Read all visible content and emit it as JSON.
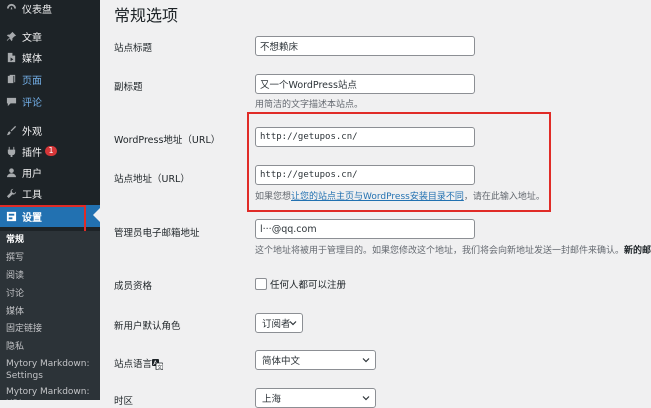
{
  "colors": {
    "sidebar_bg": "#1d2327",
    "active_bg": "#2271b1",
    "highlight_outline": "#e02b27",
    "link": "#2271b1",
    "badge": "#d63638"
  },
  "sidebar": {
    "items": [
      {
        "label": "仪表盘",
        "icon": "dashboard-icon"
      },
      {
        "label": "文章",
        "icon": "pin-icon"
      },
      {
        "label": "媒体",
        "icon": "media-icon"
      },
      {
        "label": "页面",
        "icon": "page-icon"
      },
      {
        "label": "评论",
        "icon": "comment-icon"
      },
      {
        "label": "外观",
        "icon": "brush-icon"
      },
      {
        "label": "插件",
        "icon": "plugin-icon",
        "badge": "1"
      },
      {
        "label": "用户",
        "icon": "user-icon"
      },
      {
        "label": "工具",
        "icon": "wrench-icon"
      },
      {
        "label": "设置",
        "icon": "settings-icon"
      }
    ],
    "submenu": [
      "常规",
      "撰写",
      "阅读",
      "讨论",
      "媒体",
      "固定链接",
      "隐私",
      "Mytory Markdown: Settings",
      "Mytory Markdown: URL"
    ]
  },
  "main": {
    "page_title": "常规选项",
    "site_title": {
      "label": "站点标题",
      "value": "不想赖床"
    },
    "tagline": {
      "label": "副标题",
      "value": "又一个WordPress站点",
      "description": "用简洁的文字描述本站点。"
    },
    "wp_address": {
      "label": "WordPress地址（URL）",
      "value": "http://getupos.cn/"
    },
    "site_address": {
      "label": "站点地址（URL）",
      "value": "http://getupos.cn/",
      "description_prefix": "如果您想",
      "description_link": "让您的站点主页与WordPress安装目录不同",
      "description_suffix": "，请在此输入地址。"
    },
    "admin_email": {
      "label": "管理员电子邮箱地址",
      "value": "l···@qq.com",
      "description": "这个地址将被用于管理目的。如果您修改这个地址，我们将会向新地址发送一封邮件来确认。",
      "description_bold": "新的邮箱"
    },
    "membership": {
      "label": "成员资格",
      "checkbox_label": "任何人都可以注册"
    },
    "default_role": {
      "label": "新用户默认角色",
      "value": "订阅者"
    },
    "site_language": {
      "label": "站点语言",
      "value": "简体中文"
    },
    "timezone": {
      "label": "时区",
      "value": "上海"
    }
  }
}
